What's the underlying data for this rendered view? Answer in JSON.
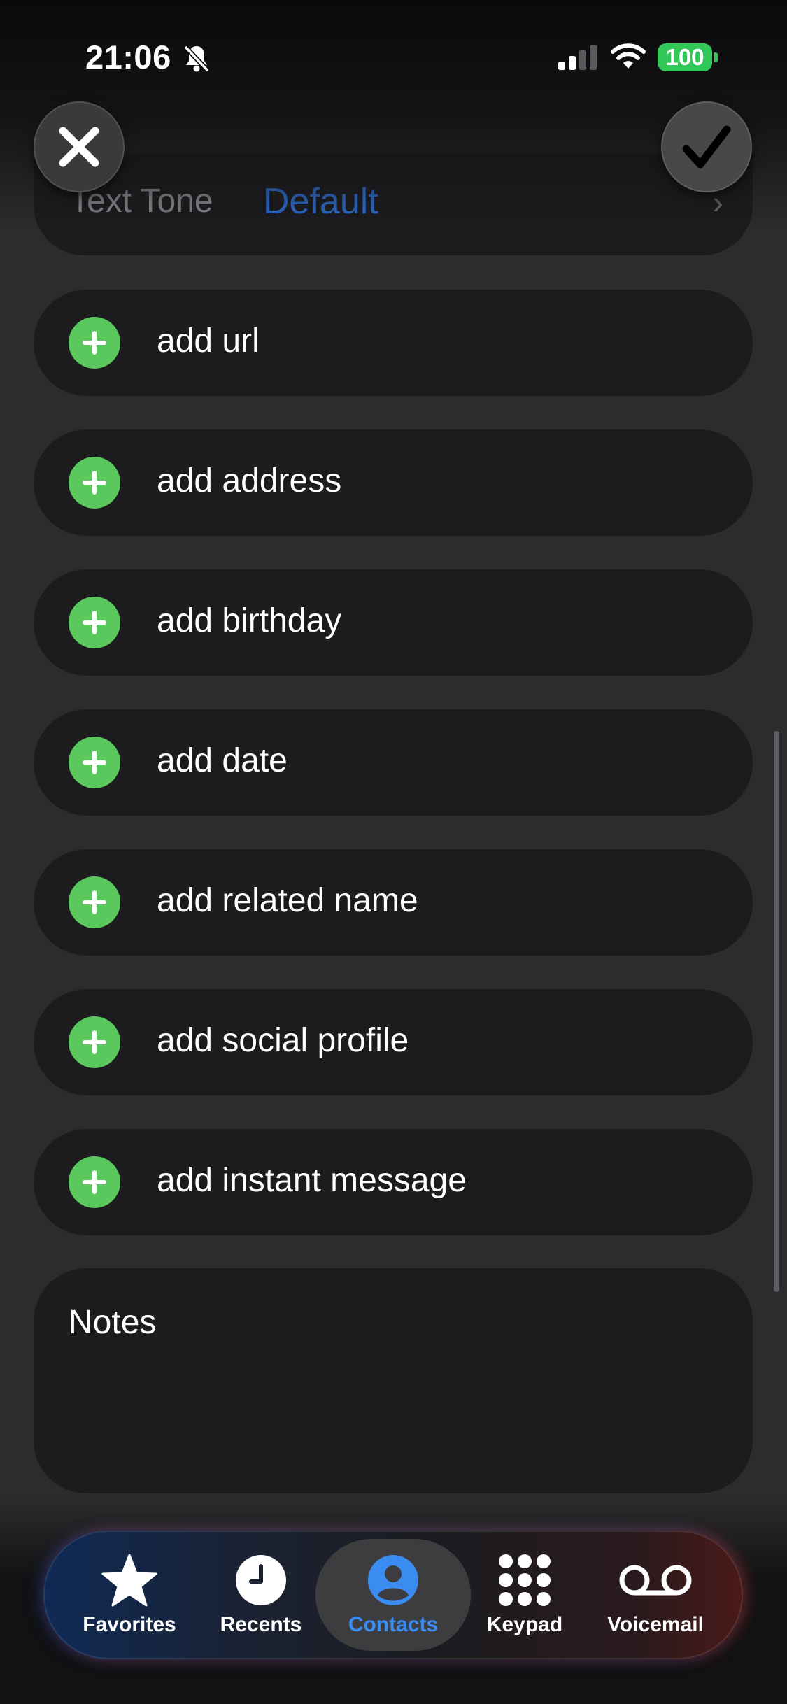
{
  "status_bar": {
    "time": "21:06",
    "battery": "100"
  },
  "header": {
    "close_icon": "xmark-icon",
    "done_icon": "checkmark-icon"
  },
  "text_tone": {
    "label": "Text Tone",
    "value": "Default"
  },
  "add_rows": [
    {
      "label": "add url"
    },
    {
      "label": "add address"
    },
    {
      "label": "add birthday"
    },
    {
      "label": "add date"
    },
    {
      "label": "add related name"
    },
    {
      "label": "add social profile"
    },
    {
      "label": "add instant message"
    }
  ],
  "notes": {
    "label": "Notes"
  },
  "tabs": [
    {
      "label": "Favorites",
      "icon": "star-icon"
    },
    {
      "label": "Recents",
      "icon": "clock-icon"
    },
    {
      "label": "Contacts",
      "icon": "person-circle-icon",
      "selected": true
    },
    {
      "label": "Keypad",
      "icon": "keypad-icon"
    },
    {
      "label": "Voicemail",
      "icon": "voicemail-icon"
    }
  ],
  "colors": {
    "accent_blue": "#3a8cf0",
    "add_green": "#5ac85c",
    "battery_green": "#32c759",
    "card": "#1c1c1e",
    "background": "#2c2c2e"
  }
}
